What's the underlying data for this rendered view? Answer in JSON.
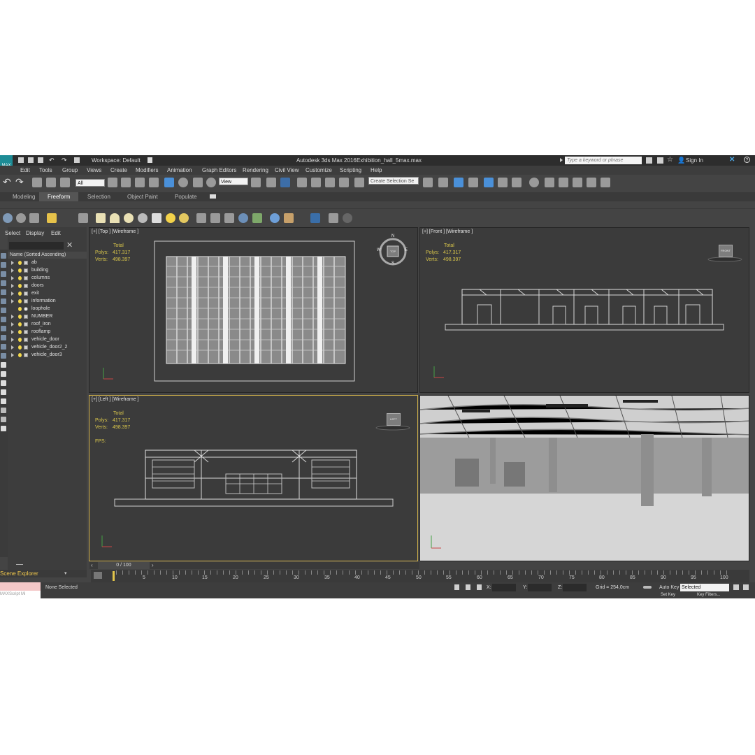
{
  "title_bar": {
    "app_title": "Autodesk 3ds Max 2016",
    "file_name": "Exhibition_hall_5max.max",
    "workspace": "Workspace: Default",
    "search_placeholder": "Type a keyword or phrase",
    "sign_in": "Sign In",
    "logo_text": "MAX"
  },
  "menu": [
    "Edit",
    "Tools",
    "Group",
    "Views",
    "Create",
    "Modifiers",
    "Animation",
    "Graph Editors",
    "Rendering",
    "Civil View",
    "Customize",
    "Scripting",
    "Help"
  ],
  "toolbar": {
    "selection_filter": "All",
    "reference_coord": "View",
    "named_selection": "Create Selection Se"
  },
  "ribbon_tabs": [
    "Modeling",
    "Freeform",
    "Selection",
    "Object Paint",
    "Populate"
  ],
  "scene_explorer": {
    "tabs": [
      "Select",
      "Display",
      "Edit"
    ],
    "column_header": "Name (Sorted Ascending)",
    "items": [
      "ab",
      "building",
      "columns",
      "doors",
      "exit",
      "information",
      "loophole",
      "NUMBER",
      "roof_iron",
      "rooflamp",
      "vehicle_door",
      "vehicle_door2_2",
      "vehicle_door3"
    ],
    "panel_title": "Scene Explorer"
  },
  "viewports": {
    "top": {
      "label": "[+] [Top ] [Wireframe ]",
      "viewcube": "TOP"
    },
    "front": {
      "label": "[+] [Front ] [Wireframe ]",
      "viewcube": "FRONT"
    },
    "left": {
      "label": "[+] [Left ] [Wireframe ]",
      "viewcube": "LEFT",
      "fps": "FPS:"
    },
    "stats": {
      "total": "Total",
      "polys_label": "Polys:",
      "polys": "417.317",
      "verts_label": "Verts:",
      "verts": "498.397"
    }
  },
  "compass": {
    "n": "N",
    "s": "S",
    "e": "E",
    "w": "W"
  },
  "timeline": {
    "frame": "0 / 100",
    "ticks": [
      "5",
      "10",
      "15",
      "20",
      "25",
      "30",
      "35",
      "40",
      "45",
      "50",
      "55",
      "60",
      "65",
      "70",
      "75",
      "80",
      "85",
      "90",
      "95",
      "100"
    ]
  },
  "status_bar": {
    "selection": "None Selected",
    "x_label": "X:",
    "y_label": "Y:",
    "z_label": "Z:",
    "grid": "Grid = 254,0cm",
    "auto_key": "Auto Key",
    "key_mode": "Selected",
    "set_key": "Set Key",
    "key_filters": "Key Filters...",
    "maxscript": "MAXScript Mi"
  }
}
